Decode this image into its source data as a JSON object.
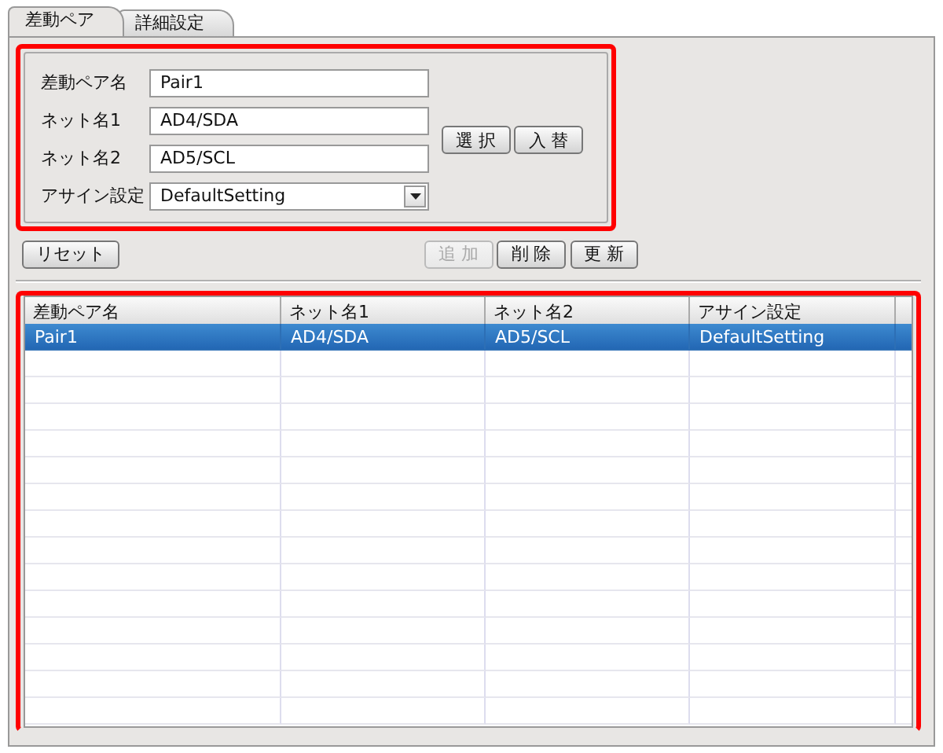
{
  "tabs": [
    {
      "label": "差動ペア",
      "selected": true
    },
    {
      "label": "詳細設定",
      "selected": false
    }
  ],
  "form": {
    "highlighted": true,
    "fields": [
      {
        "label": "差動ペア名",
        "value": "Pair1",
        "kind": "text"
      },
      {
        "label": "ネット名1",
        "value": "AD4/SDA",
        "kind": "text"
      },
      {
        "label": "ネット名2",
        "value": "AD5/SCL",
        "kind": "text"
      },
      {
        "label": "アサイン設定",
        "value": "DefaultSetting",
        "kind": "dropdown"
      }
    ],
    "side_buttons": [
      {
        "label": "選 択",
        "disabled": false
      },
      {
        "label": "入 替",
        "disabled": false
      }
    ]
  },
  "reset_button": {
    "label": "リセット",
    "disabled": false
  },
  "action_buttons": [
    {
      "label": "追 加",
      "disabled": true
    },
    {
      "label": "削 除",
      "disabled": false
    },
    {
      "label": "更 新",
      "disabled": false
    }
  ],
  "table": {
    "highlighted": true,
    "columns": [
      "差動ペア名",
      "ネット名1",
      "ネット名2",
      "アサイン設定"
    ],
    "rows": [
      {
        "cells": [
          "Pair1",
          "AD4/SDA",
          "AD5/SCL",
          "DefaultSetting"
        ],
        "selected": true
      }
    ]
  }
}
